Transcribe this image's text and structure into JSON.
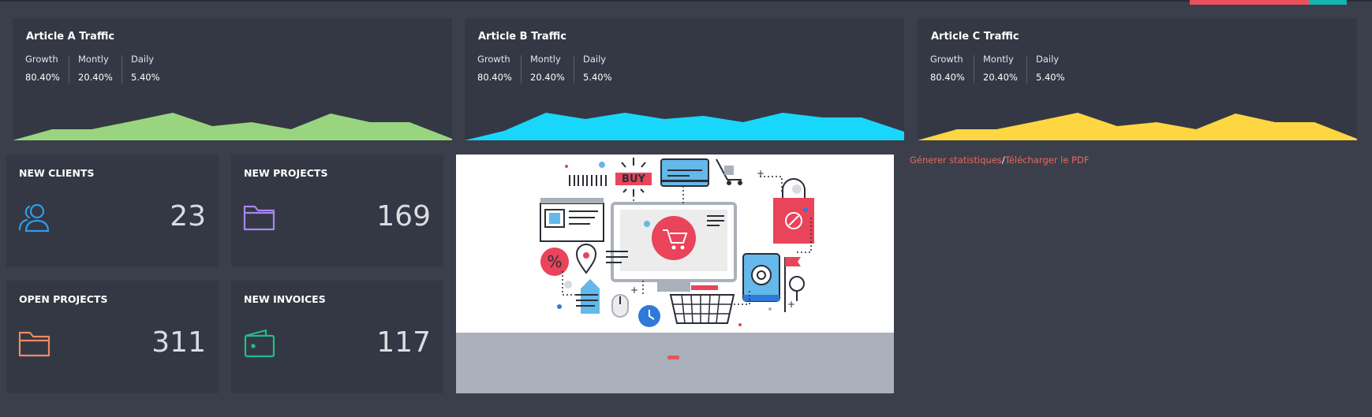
{
  "articles": [
    {
      "title": "Article A Traffic",
      "color": "#99d57f",
      "stats": [
        {
          "label": "Growth",
          "value": "80.40%"
        },
        {
          "label": "Montly",
          "value": "20.40%"
        },
        {
          "label": "Daily",
          "value": "5.40%"
        }
      ]
    },
    {
      "title": "Article B Traffic",
      "color": "#19d7fb",
      "stats": [
        {
          "label": "Growth",
          "value": "80.40%"
        },
        {
          "label": "Montly",
          "value": "20.40%"
        },
        {
          "label": "Daily",
          "value": "5.40%"
        }
      ]
    },
    {
      "title": "Article C Traffic",
      "color": "#fed642",
      "stats": [
        {
          "label": "Growth",
          "value": "80.40%"
        },
        {
          "label": "Montly",
          "value": "20.40%"
        },
        {
          "label": "Daily",
          "value": "5.40%"
        }
      ]
    }
  ],
  "cards": [
    {
      "label": "NEW CLIENTS",
      "value": "23",
      "icon": "users-icon",
      "color": "#2f9ce8"
    },
    {
      "label": "NEW PROJECTS",
      "value": "169",
      "icon": "folder-icon",
      "color": "#a987f0"
    },
    {
      "label": "OPEN PROJECTS",
      "value": "311",
      "icon": "folder-open-icon",
      "color": "#f08a63"
    },
    {
      "label": "NEW INVOICES",
      "value": "117",
      "icon": "wallet-icon",
      "color": "#1fbf88"
    }
  ],
  "banner": {
    "buy_label": "BUY",
    "percent_label": "%"
  },
  "links": {
    "stats": "Génerer statistiques",
    "separator": "/",
    "pdf": "Télécharger le PDF"
  }
}
